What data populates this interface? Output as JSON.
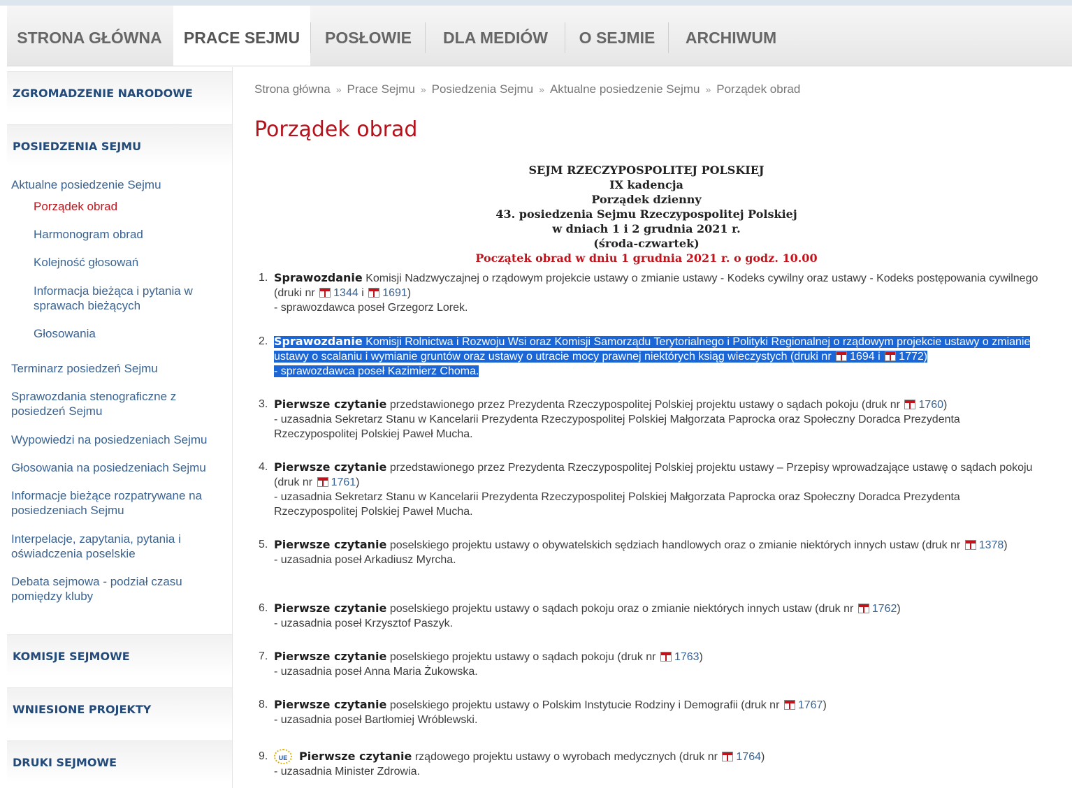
{
  "nav": {
    "items": [
      {
        "label": "STRONA GŁÓWNA"
      },
      {
        "label": "PRACE SEJMU"
      },
      {
        "label": "POSŁOWIE"
      },
      {
        "label": "DLA MEDIÓW"
      },
      {
        "label": "O SEJMIE"
      },
      {
        "label": "ARCHIWUM"
      }
    ],
    "active": "PRACE SEJMU"
  },
  "sidebar": {
    "sections": [
      {
        "label": "ZGROMADZENIE NARODOWE"
      },
      {
        "label": "POSIEDZENIA SEJMU"
      },
      {
        "label": "KOMISJE SEJMOWE"
      },
      {
        "label": "WNIESIONE PROJEKTY"
      },
      {
        "label": "DRUKI SEJMOWE"
      }
    ],
    "links": [
      {
        "label": "Aktualne posiedzenie Sejmu"
      },
      {
        "label": "Porządek obrad"
      },
      {
        "label": "Harmonogram obrad"
      },
      {
        "label": "Kolejność głosowań"
      },
      {
        "label": "Informacja bieżąca i pytania w sprawach bieżących"
      },
      {
        "label": "Głosowania"
      },
      {
        "label": "Terminarz posiedzeń Sejmu"
      },
      {
        "label": "Sprawozdania stenograficzne z posiedzeń Sejmu"
      },
      {
        "label": "Wypowiedzi na posiedzeniach Sejmu"
      },
      {
        "label": "Głosowania na posiedzeniach Sejmu"
      },
      {
        "label": "Informacje bieżące rozpatrywane na posiedzeniach Sejmu"
      },
      {
        "label": "Interpelacje, zapytania, pytania i oświadczenia poselskie"
      },
      {
        "label": "Debata sejmowa - podział czasu pomiędzy kluby"
      }
    ]
  },
  "breadcrumb": [
    "Strona główna",
    "Prace Sejmu",
    "Posiedzenia Sejmu",
    "Aktualne posiedzenie Sejmu",
    "Porządek obrad"
  ],
  "breadcrumb_separator": "»",
  "page_title": "Porządek obrad",
  "heading": {
    "line1": "SEJM RZECZYPOSPOLITEJ POLSKIEJ",
    "line2": "IX kadencja",
    "line3": "Porządek dzienny",
    "line4": "43. posiedzenia Sejmu Rzeczypospolitej Polskiej",
    "line5": "w dniach 1 i 2 grudnia 2021 r.",
    "line6": "(środa-czwartek)",
    "start": "Początek obrad w dniu 1 grudnia 2021 r. o godz. 10.00"
  },
  "agenda": [
    {
      "num": "1.",
      "type": "Sprawozdanie",
      "text": "Komisji Nadzwyczajnej o rządowym projekcie ustawy o zmianie ustawy - Kodeks cywilny oraz ustawy - Kodeks postępowania cywilnego (druki nr",
      "doc1": "1344",
      "connector": "i",
      "doc2": "1691",
      "close": ")",
      "reporter": "- sprawozdawca poseł Grzegorz Lorek."
    },
    {
      "num": "2.",
      "type": "Sprawozdanie",
      "text": "Komisji Rolnictwa i Rozwoju Wsi oraz Komisji Samorządu Terytorialnego i Polityki Regionalnej o rządowym projekcie ustawy o zmianie ustawy o scalaniu i wymianie gruntów oraz ustawy o utracie mocy prawnej niektórych ksiąg wieczystych (druki nr",
      "doc1": "1694",
      "connector": "i",
      "doc2": "1772",
      "close": ")",
      "reporter": "- sprawozdawca poseł Kazimierz Choma.",
      "selected": true
    },
    {
      "num": "3.",
      "type": "Pierwsze czytanie",
      "text": "przedstawionego przez Prezydenta Rzeczypospolitej Polskiej projektu ustawy o sądach pokoju (druk nr",
      "doc1": "1760",
      "close": ")",
      "reporter": "- uzasadnia Sekretarz Stanu w Kancelarii Prezydenta Rzeczypospolitej Polskiej Małgorzata Paprocka oraz Społeczny Doradca Prezydenta Rzeczypospolitej Polskiej Paweł Mucha."
    },
    {
      "num": "4.",
      "type": "Pierwsze czytanie",
      "text": "przedstawionego przez Prezydenta Rzeczypospolitej Polskiej projektu ustawy – Przepisy wprowadzające ustawę o sądach pokoju (druk nr",
      "doc1": "1761",
      "close": ")",
      "reporter": "- uzasadnia Sekretarz Stanu w Kancelarii Prezydenta Rzeczypospolitej Polskiej Małgorzata Paprocka oraz Społeczny Doradca Prezydenta Rzeczypospolitej Polskiej Paweł Mucha."
    },
    {
      "num": "5.",
      "type": "Pierwsze czytanie",
      "text": "poselskiego projektu ustawy o obywatelskich sędziach handlowych oraz o zmianie niektórych innych ustaw (druk nr",
      "doc1": "1378",
      "close": ")",
      "reporter": "- uzasadnia poseł Arkadiusz Myrcha."
    },
    {
      "num": "6.",
      "type": "Pierwsze czytanie",
      "text": "poselskiego projektu ustawy o sądach pokoju oraz o zmianie niektórych innych ustaw (druk nr",
      "doc1": "1762",
      "close": ")",
      "reporter": "- uzasadnia poseł Krzysztof Paszyk."
    },
    {
      "num": "7.",
      "type": "Pierwsze czytanie",
      "text": "poselskiego projektu ustawy o sądach pokoju (druk nr",
      "doc1": "1763",
      "close": ")",
      "reporter": "- uzasadnia poseł Anna Maria Żukowska."
    },
    {
      "num": "8.",
      "type": "Pierwsze czytanie",
      "text": "poselskiego projektu ustawy o Polskim Instytucie Rodziny i Demografii (druk nr",
      "doc1": "1767",
      "close": ")",
      "reporter": "- uzasadnia poseł Bartłomiej Wróblewski."
    },
    {
      "num": "9.",
      "badge": "UE",
      "type": "Pierwsze czytanie",
      "text": "rządowego projektu ustawy o wyrobach medycznych (druk nr",
      "doc1": "1764",
      "close": ")",
      "reporter": "- uzasadnia Minister Zdrowia."
    }
  ]
}
